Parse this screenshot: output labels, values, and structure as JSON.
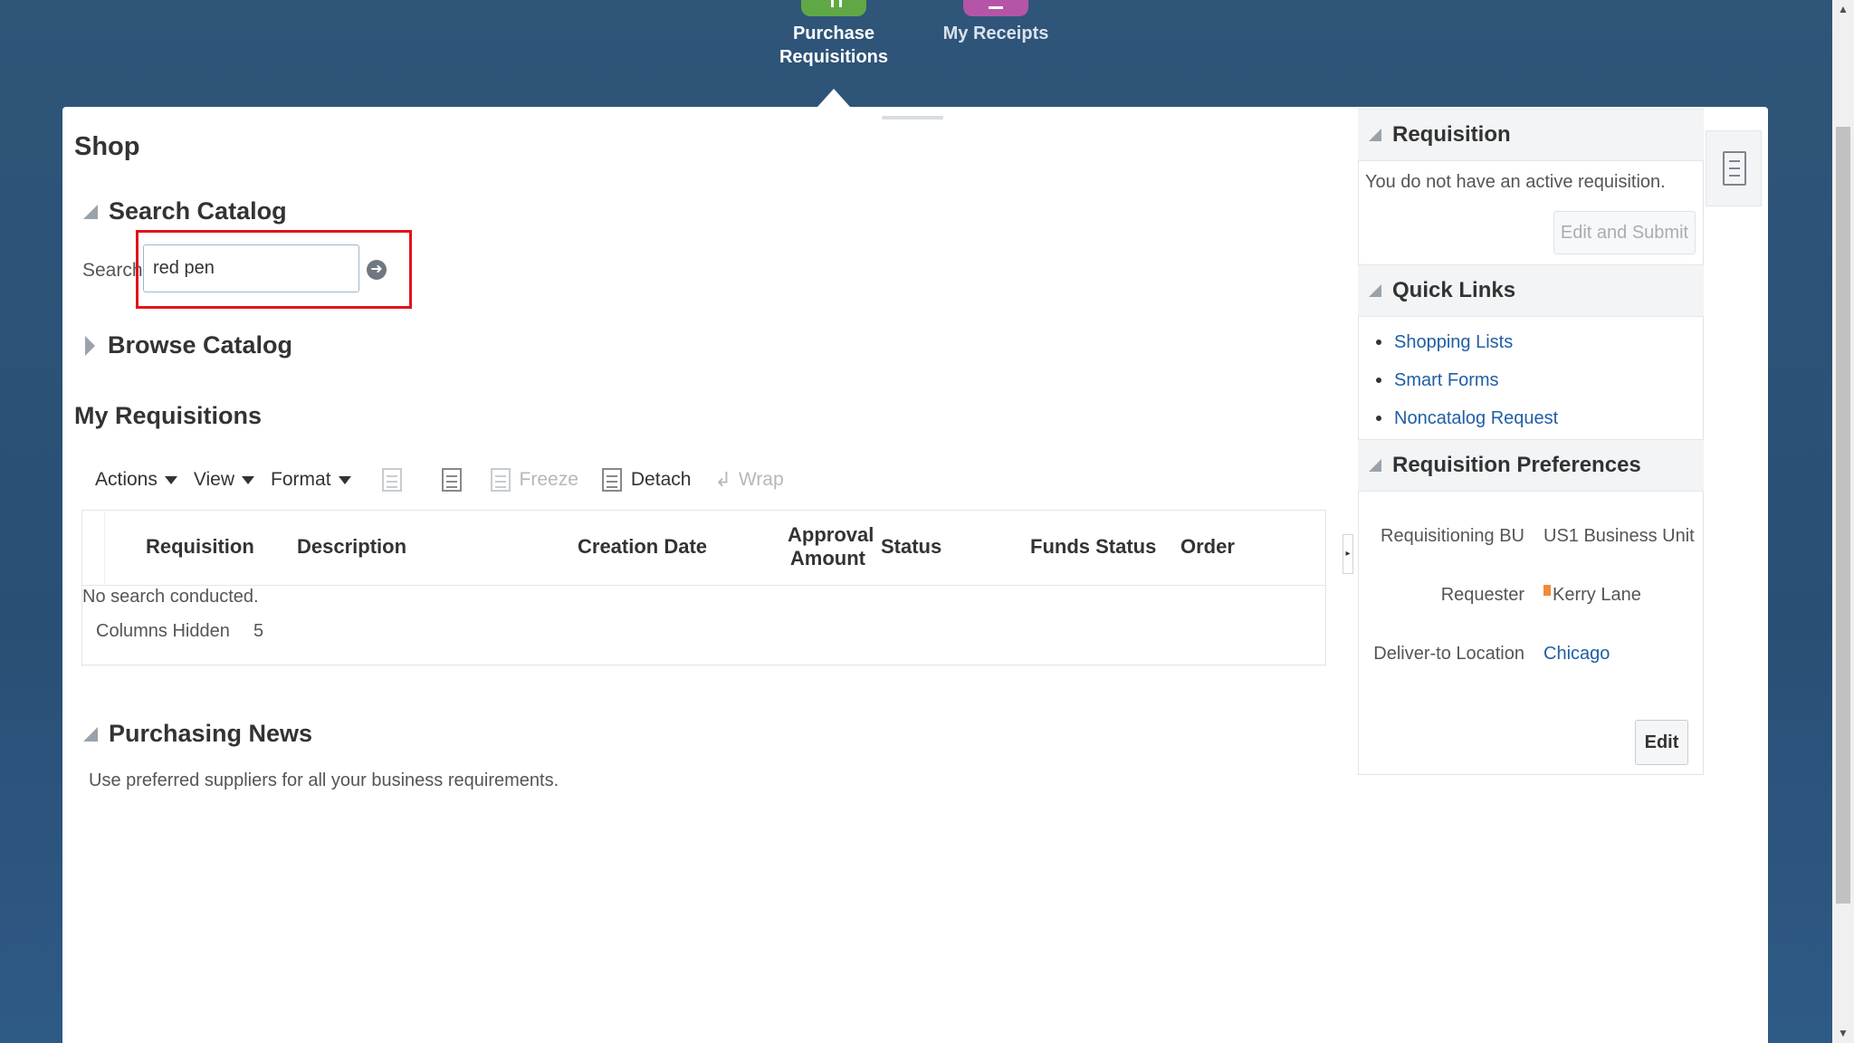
{
  "nav": {
    "purchase_requisitions_line1": "Purchase",
    "purchase_requisitions_line2": "Requisitions",
    "my_receipts": "My Receipts"
  },
  "page_title": "Shop",
  "search_catalog": {
    "heading": "Search Catalog",
    "label": "Search",
    "value": "red pen"
  },
  "browse_catalog": {
    "heading": "Browse Catalog"
  },
  "my_requisitions": {
    "heading": "My Requisitions",
    "toolbar": {
      "actions": "Actions",
      "view": "View",
      "format": "Format",
      "freeze": "Freeze",
      "detach": "Detach",
      "wrap": "Wrap"
    },
    "columns": {
      "requisition": "Requisition",
      "description": "Description",
      "creation_date": "Creation Date",
      "approval_amount_line1": "Approval",
      "approval_amount_line2": "Amount",
      "status": "Status",
      "funds_status": "Funds Status",
      "order": "Order"
    },
    "empty_message": "No search conducted.",
    "columns_hidden_label": "Columns Hidden",
    "columns_hidden_count": "5"
  },
  "purchasing_news": {
    "heading": "Purchasing News",
    "text": "Use preferred suppliers for all your business requirements."
  },
  "requisition_panel": {
    "heading": "Requisition",
    "message": "You do not have an active requisition.",
    "edit_submit": "Edit and Submit"
  },
  "quick_links": {
    "heading": "Quick Links",
    "items": [
      "Shopping Lists",
      "Smart Forms",
      "Noncatalog Request"
    ]
  },
  "preferences": {
    "heading": "Requisition Preferences",
    "bu_label": "Requisitioning BU",
    "bu_value": "US1 Business Unit",
    "requester_label": "Requester",
    "requester_value": "Kerry Lane",
    "location_label": "Deliver-to Location",
    "location_value": "Chicago",
    "edit": "Edit"
  },
  "colors": {
    "background": "#2f5579",
    "purchase_tile": "#5fa845",
    "receipts_tile": "#b455a8",
    "highlight": "#e0141b",
    "link": "#1f5fa4"
  }
}
